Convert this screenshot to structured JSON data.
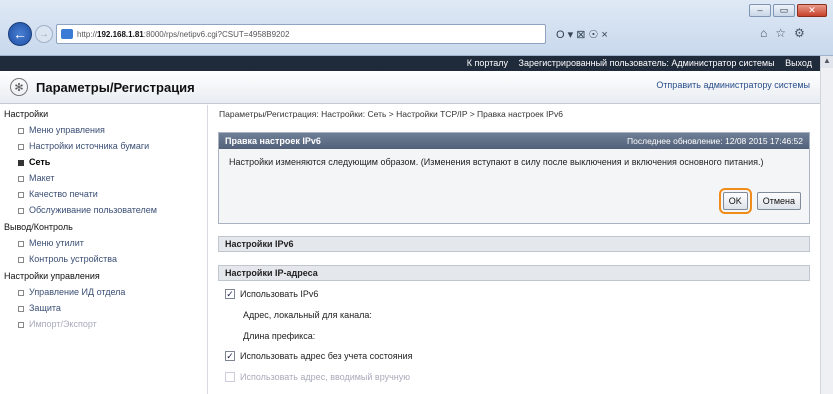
{
  "browser": {
    "url_prefix": "http://",
    "url_host": "192.168.1.81",
    "url_rest": ":8000/rps/netipv6.cgi?CSUT=4958B9202",
    "search_hint": "Ο ▾ ⊠ ☉ ×",
    "window_buttons": [
      "–",
      "▭",
      "✕"
    ]
  },
  "topbar": {
    "links": [
      "К порталу",
      "Зарегистрированный пользователь: Администратор системы",
      "Выход"
    ]
  },
  "app": {
    "title": "Параметры/Регистрация",
    "send_link": "Отправить администратору системы"
  },
  "sidebar": {
    "groups": [
      {
        "heading": "Настройки",
        "items": [
          {
            "label": "Меню управления"
          },
          {
            "label": "Настройки источника бумаги"
          },
          {
            "label": "Сеть",
            "active": true
          },
          {
            "label": "Макет"
          },
          {
            "label": "Качество печати"
          },
          {
            "label": "Обслуживание пользователем"
          }
        ]
      },
      {
        "heading": "Вывод/Контроль",
        "items": [
          {
            "label": "Меню утилит"
          },
          {
            "label": "Контроль устройства"
          }
        ]
      },
      {
        "heading": "Настройки управления",
        "items": [
          {
            "label": "Управление ИД отдела"
          },
          {
            "label": "Защита"
          },
          {
            "label": "Импорт/Экспорт"
          }
        ]
      }
    ]
  },
  "main": {
    "breadcrumb": "Параметры/Регистрация: Настройки: Сеть > Настройки TCP/IP > Правка настроек IPv6",
    "panel": {
      "title": "Правка настроек IPv6",
      "last_update": "Последнее обновление: 12/08 2015 17:46:52",
      "message": "Настройки изменяются следующим образом. (Изменения вступают в силу после выключения и включения основного питания.)",
      "ok_label": "OK",
      "cancel_label": "Отмена"
    },
    "section_ipv6": "Настройки IPv6",
    "section_ip": "Настройки IP-адреса",
    "use_ipv6": "Использовать IPv6",
    "link_local": "Адрес, локальный для канала:",
    "prefix_length": "Длина префикса:",
    "stateless": "Использовать адрес без учета состояния",
    "manual": "Использовать адрес, вводимый вручную"
  }
}
